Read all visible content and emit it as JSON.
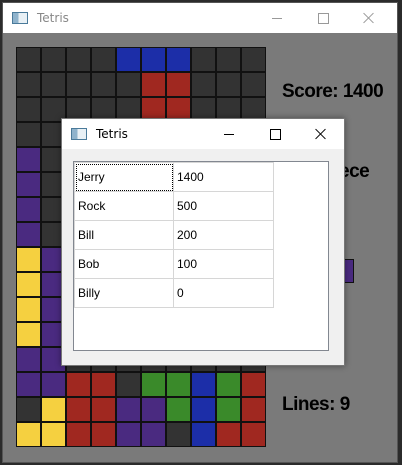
{
  "main_window": {
    "title": "Tetris"
  },
  "side": {
    "score": "Score: 1400",
    "next_label": "ece",
    "lines": "Lines: 9"
  },
  "colors": {
    "empty": "#333333",
    "blue": "#1c2ea8",
    "red": "#a02820",
    "purple": "#4a2a80",
    "yellow": "#f5d040",
    "green": "#3a8a2a"
  },
  "board": [
    "EEEEBBBEEE",
    "EEEEERREEE",
    "EEEEERREEE",
    "EEEEEEEEEE",
    "PEEEEEEEEE",
    "PEEEEEEEEE",
    "PEEEEEEEEE",
    "PEEEEEEEEE",
    "YPEEEEEEEE",
    "YPEEEEEEEE",
    "YPEEEEEEEE",
    "YPEEEEEEEE",
    "PPEEEEEEEE",
    "PPRREGGBGR",
    "EYRRPPGBGR",
    "YYRRPPEBRR"
  ],
  "dialog": {
    "title": "Tetris",
    "rows": [
      {
        "name": "Jerry",
        "score": "1400"
      },
      {
        "name": "Rock",
        "score": "500"
      },
      {
        "name": "Bill",
        "score": "200"
      },
      {
        "name": "Bob",
        "score": "100"
      },
      {
        "name": "Billy",
        "score": "0"
      }
    ]
  }
}
